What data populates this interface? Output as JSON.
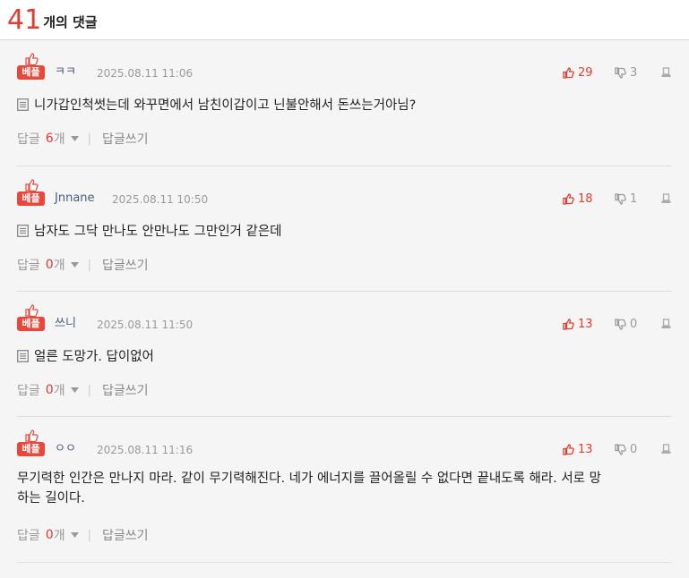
{
  "header": {
    "count": "41",
    "label": "개의 댓글"
  },
  "best_label": "베플",
  "reply_label": "답글",
  "reply_unit": "개",
  "write_reply_label": "답글쓰기",
  "comments": [
    {
      "nickname": "ㅋㅋ",
      "date": "2025.08.11 11:06",
      "likes": "29",
      "dislikes": "3",
      "text": "니가갑인척썻는데 와꾸면에서 남친이갑이고 닌불안해서 돈쓰는거아님?",
      "replies": "6"
    },
    {
      "nickname": "Jnnane",
      "date": "2025.08.11 10:50",
      "likes": "18",
      "dislikes": "1",
      "text": "남자도 그닥 만나도 안만나도 그만인거 같은데",
      "replies": "0"
    },
    {
      "nickname": "쓰니",
      "date": "2025.08.11 11:50",
      "likes": "13",
      "dislikes": "0",
      "text": "얼른 도망가. 답이없어",
      "replies": "0"
    },
    {
      "nickname": "ㅇㅇ",
      "date": "2025.08.11 11:16",
      "likes": "13",
      "dislikes": "0",
      "text_line1": "무기력한 인간은 만나지 마라. 같이 무기력해진다. 네가 에너지를 끌어올릴 수 없다면 끝내도록 해라. 서로 망",
      "text_line2": "하는 길이다.",
      "replies": "0"
    }
  ],
  "colors": {
    "accent": "#e23b30",
    "best_bg": "#e8483b",
    "nickname": "#4b5b7a"
  },
  "icons": [
    "thumbs-up-icon",
    "thumbs-down-icon",
    "report-icon",
    "memo-icon",
    "chevron-down-icon",
    "best-thumb-icon"
  ]
}
